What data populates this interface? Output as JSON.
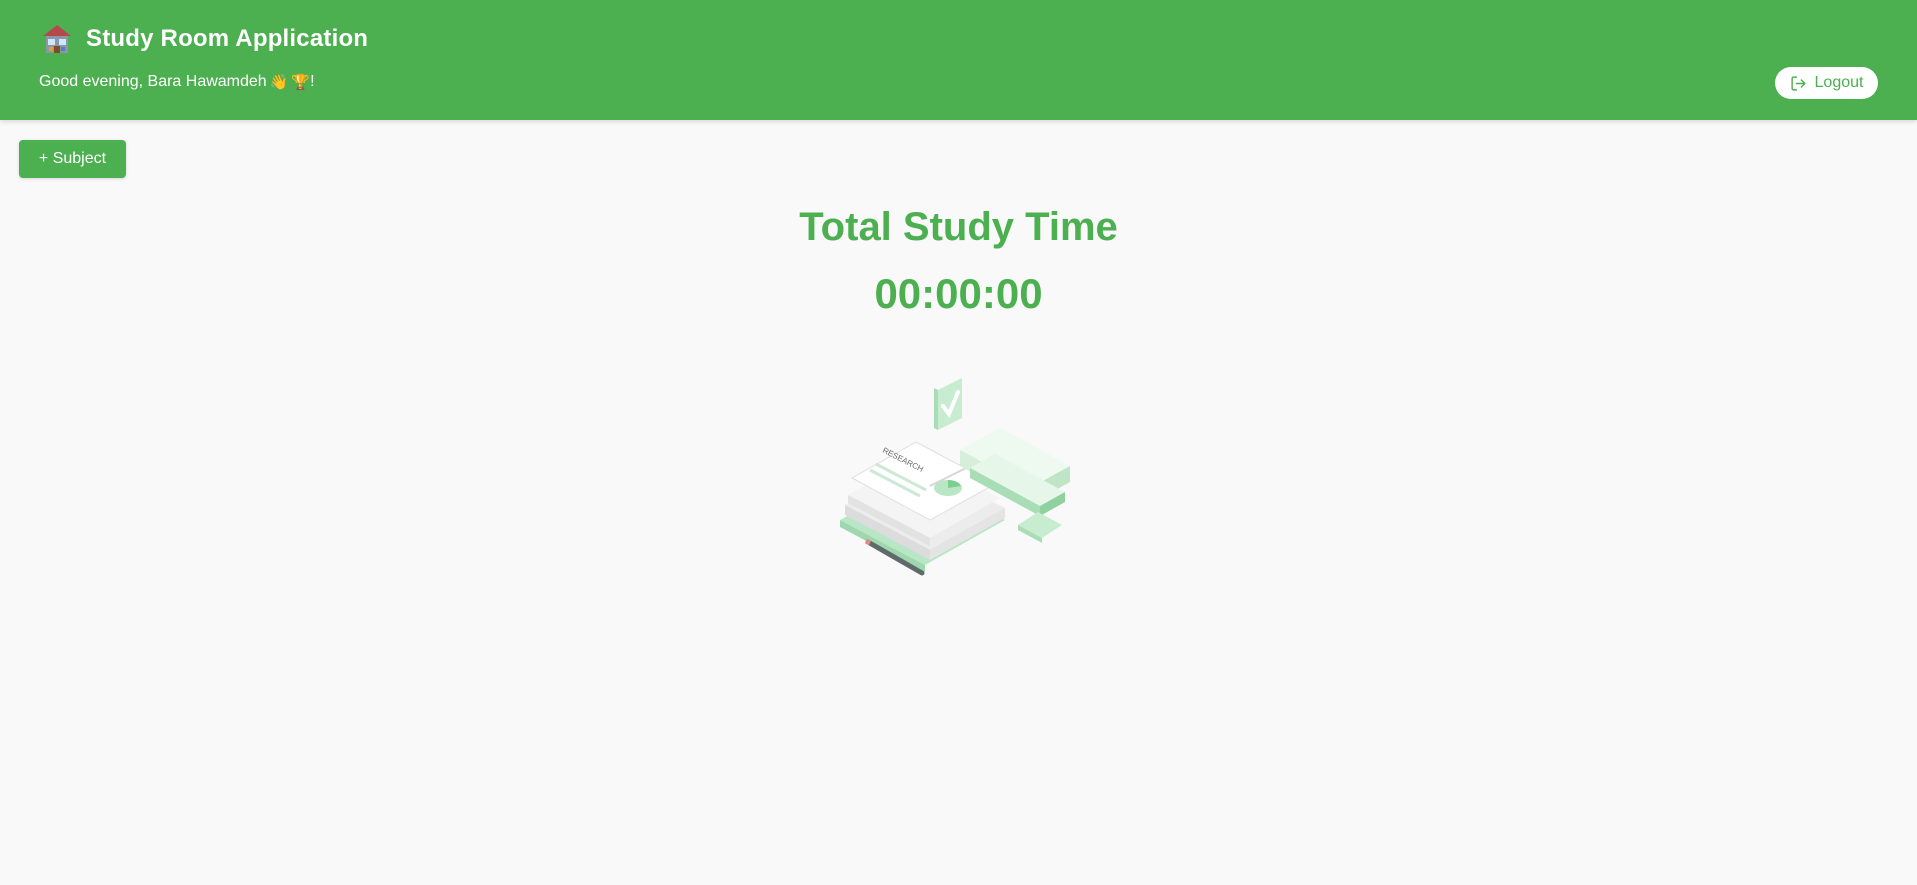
{
  "header": {
    "app_title": "Study Room Application",
    "logo_icon": "house-icon",
    "greeting_text": "Good evening, Bara Hawamdeh",
    "greeting_emoji_1": "👋",
    "greeting_emoji_2": "🏆",
    "greeting_suffix": "!",
    "logout_label": "Logout",
    "logout_icon": "logout-icon"
  },
  "toolbar": {
    "add_subject_label": "+ Subject"
  },
  "main": {
    "total_title": "Total Study Time",
    "timer_value": "00:00:00",
    "illustration_label": "RESEARCH"
  },
  "colors": {
    "brand_green": "#4caf50",
    "background": "#f9f9f9",
    "white": "#ffffff"
  }
}
